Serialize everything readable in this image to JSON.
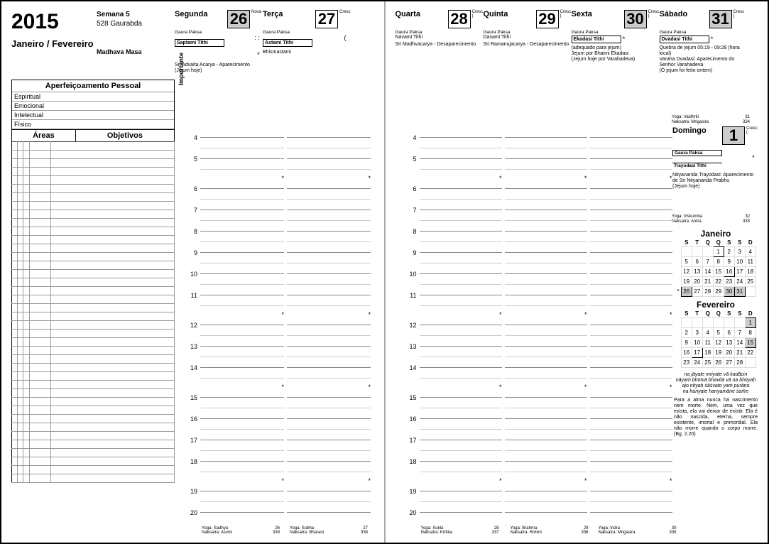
{
  "year": "2015",
  "months_label": "Janeiro / Fevereiro",
  "week_label": "Semana 5",
  "gaurabda": "528 Gaurabda",
  "masa": "Madhava Masa",
  "importante_label": "Importante",
  "personal": {
    "title": "Aperfeiçoamento Pessoal",
    "rows": [
      "Espiritual",
      "Emocional",
      "Intelectual",
      "Físico"
    ]
  },
  "areas_label": "Áreas",
  "objetivos_label": "Objetivos",
  "hours": [
    "4",
    "5",
    "6",
    "7",
    "8",
    "9",
    "10",
    "11",
    "12",
    "13",
    "14",
    "15",
    "16",
    "17",
    "18",
    "19",
    "20"
  ],
  "days": [
    {
      "wd": "Segunda",
      "num": "26",
      "moon": "Nova",
      "moon_sym": ": :",
      "mark": "*",
      "paksa": "Gaura Paksa",
      "tithi": "Saptami Tithi",
      "events": "Sri Advaita Acarya - Aparecimento\n(Jejum hoje)",
      "shade": true,
      "yoga": "Yoga: Sadhya",
      "nak": "Naksatra: Asvini",
      "ynum": "26",
      "nnum": "339"
    },
    {
      "wd": "Terça",
      "num": "27",
      "moon": "Cresc",
      "moon_sym": "(",
      "mark": "",
      "paksa": "Gaura Paksa",
      "tithi": "Astami Tithi",
      "events": "Bhismastami",
      "shade": false,
      "yoga": "Yoga: Subha",
      "nak": "Naksatra: Bharani",
      "ynum": "27",
      "nnum": "338"
    },
    {
      "wd": "Quarta",
      "num": "28",
      "moon": "Cresc",
      "moon_sym": "(",
      "mark": "",
      "paksa": "Gaura Paksa",
      "tithi": "Navami Tithi",
      "events": "Sri Madhvacarya - Desaparecimento",
      "shade": false,
      "yoga": "Yoga: Sukla",
      "nak": "Naksatra: Krttika",
      "ynum": "28",
      "nnum": "337"
    },
    {
      "wd": "Quinta",
      "num": "29",
      "moon": "Cresc",
      "moon_sym": "(",
      "mark": "",
      "paksa": "Gaura Paksa",
      "tithi": "Dasami Tithi",
      "events": "Sri Ramanujacarya - Desaparecimento",
      "shade": false,
      "yoga": "Yoga: Brahma",
      "nak": "Naksatra: Rohini",
      "ynum": "29",
      "nnum": "336"
    },
    {
      "wd": "Sexta",
      "num": "30",
      "moon": "Cresc",
      "moon_sym": "(",
      "mark": "*",
      "paksa": "Gaura Paksa",
      "tithi": "Ekadasi Tithi",
      "events": "(adequado para jejum)\nJejum por Bhaimi Ekadasi\n(Jejum hoje por Varahadeva)",
      "shade": true,
      "yoga": "Yoga: Indra",
      "nak": "Naksatra: Mrigasira",
      "ynum": "30",
      "nnum": "335"
    },
    {
      "wd": "Sábado",
      "num": "31",
      "moon": "Cresc",
      "moon_sym": "(",
      "mark": "*",
      "paksa": "Gaura Paksa",
      "tithi": "Dvadasi Tithi",
      "events": "Quebra de jejum 05:19 - 09:28 (hora local)\nVaraha Dvadasi: Aparecimento do Senhor Varahadeva\n(O jejum foi feito ontem)",
      "shade": true,
      "yoga": "Yoga: Vaidhriti",
      "nak": "Naksatra: Mrigasira",
      "ynum": "31",
      "nnum": "334"
    },
    {
      "wd": "Domingo",
      "num": "1",
      "moon": "Cresc",
      "moon_sym": "(",
      "mark": "*",
      "paksa": "Gaura Paksa",
      "tithi": "Trayodasi Tithi",
      "events": "Nityananda Trayodasi: Aparecimento de Sri Nityananda Prabhu\n(Jejum hoje)",
      "shade": true,
      "yoga": "Yoga: Viskumba",
      "nak": "Naksatra: Ardra",
      "ynum": "32",
      "nnum": "333"
    }
  ],
  "minicals": [
    {
      "title": "Janeiro",
      "dow": [
        "S",
        "T",
        "Q",
        "Q",
        "S",
        "S",
        "D"
      ],
      "rows": [
        [
          "",
          "",
          "",
          "",
          "1",
          "2",
          "3",
          "4"
        ],
        [
          "",
          "5",
          "6",
          "7",
          "8",
          "9",
          "10",
          "11"
        ],
        [
          "",
          "12",
          "13",
          "14",
          "15",
          "16",
          "17",
          "18"
        ],
        [
          "",
          "19",
          "20",
          "21",
          "22",
          "23",
          "24",
          "25"
        ],
        [
          "*",
          "26",
          "27",
          "28",
          "29",
          "30",
          "31",
          ""
        ]
      ],
      "hl": [
        "26",
        "30",
        "31"
      ],
      "bx": [
        "1",
        "16"
      ]
    },
    {
      "title": "Fevereiro",
      "dow": [
        "S",
        "T",
        "Q",
        "Q",
        "S",
        "S",
        "D"
      ],
      "rows": [
        [
          "",
          "",
          "",
          "",
          "",
          "",
          "",
          "1"
        ],
        [
          "",
          "2",
          "3",
          "4",
          "5",
          "6",
          "7",
          "8"
        ],
        [
          "",
          "9",
          "10",
          "11",
          "12",
          "13",
          "14",
          "15"
        ],
        [
          "",
          "16",
          "17",
          "18",
          "19",
          "20",
          "21",
          "22"
        ],
        [
          "",
          "23",
          "24",
          "25",
          "26",
          "27",
          "28",
          ""
        ]
      ],
      "hl": [
        "1",
        "15"
      ],
      "bx": [
        "17"
      ]
    }
  ],
  "quote": {
    "sanskrit": "na jāyate mriyate vā kadācin\nnāyaṁ bhūtvā bhavitā vā na bhūyaḥ\najo nityaḥ śāśvato yaṁ purāṇo\nna hanyate hanyamāne śarīre",
    "pt": "Para a alma nunca há nascimento nem morte. Nem, uma vez que exista, ela vai deixar de existir. Ela é não nascida, eterna, sempre existente, imortal e primordial. Ela não morre quando o corpo morre. (Bg. 2.20)"
  }
}
